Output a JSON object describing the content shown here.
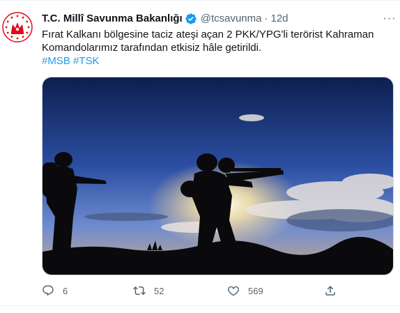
{
  "tweet": {
    "display_name": "T.C. Millî Savunma Bakanlığı",
    "handle": "@tcsavunma",
    "separator": "·",
    "time": "12d",
    "more_label": "···",
    "text_line1": "Fırat Kalkanı bölgesine taciz ateşi açan 2 PKK/YPG'li terörist Kahraman",
    "text_line2": "Komandolarımız tarafından etkisiz hâle getirildi.",
    "hashtags": [
      "#MSB",
      "#TSK"
    ]
  },
  "actions": {
    "reply_count": "6",
    "retweet_count": "52",
    "like_count": "569"
  },
  "colors": {
    "link": "#1d9bf0",
    "verified": "#1d9bf0",
    "muted": "#536471",
    "avatar_red": "#e30a17"
  },
  "icons": {
    "verified": "verified-badge-icon",
    "reply": "reply-icon",
    "retweet": "retweet-icon",
    "like": "heart-icon",
    "share": "share-icon"
  }
}
